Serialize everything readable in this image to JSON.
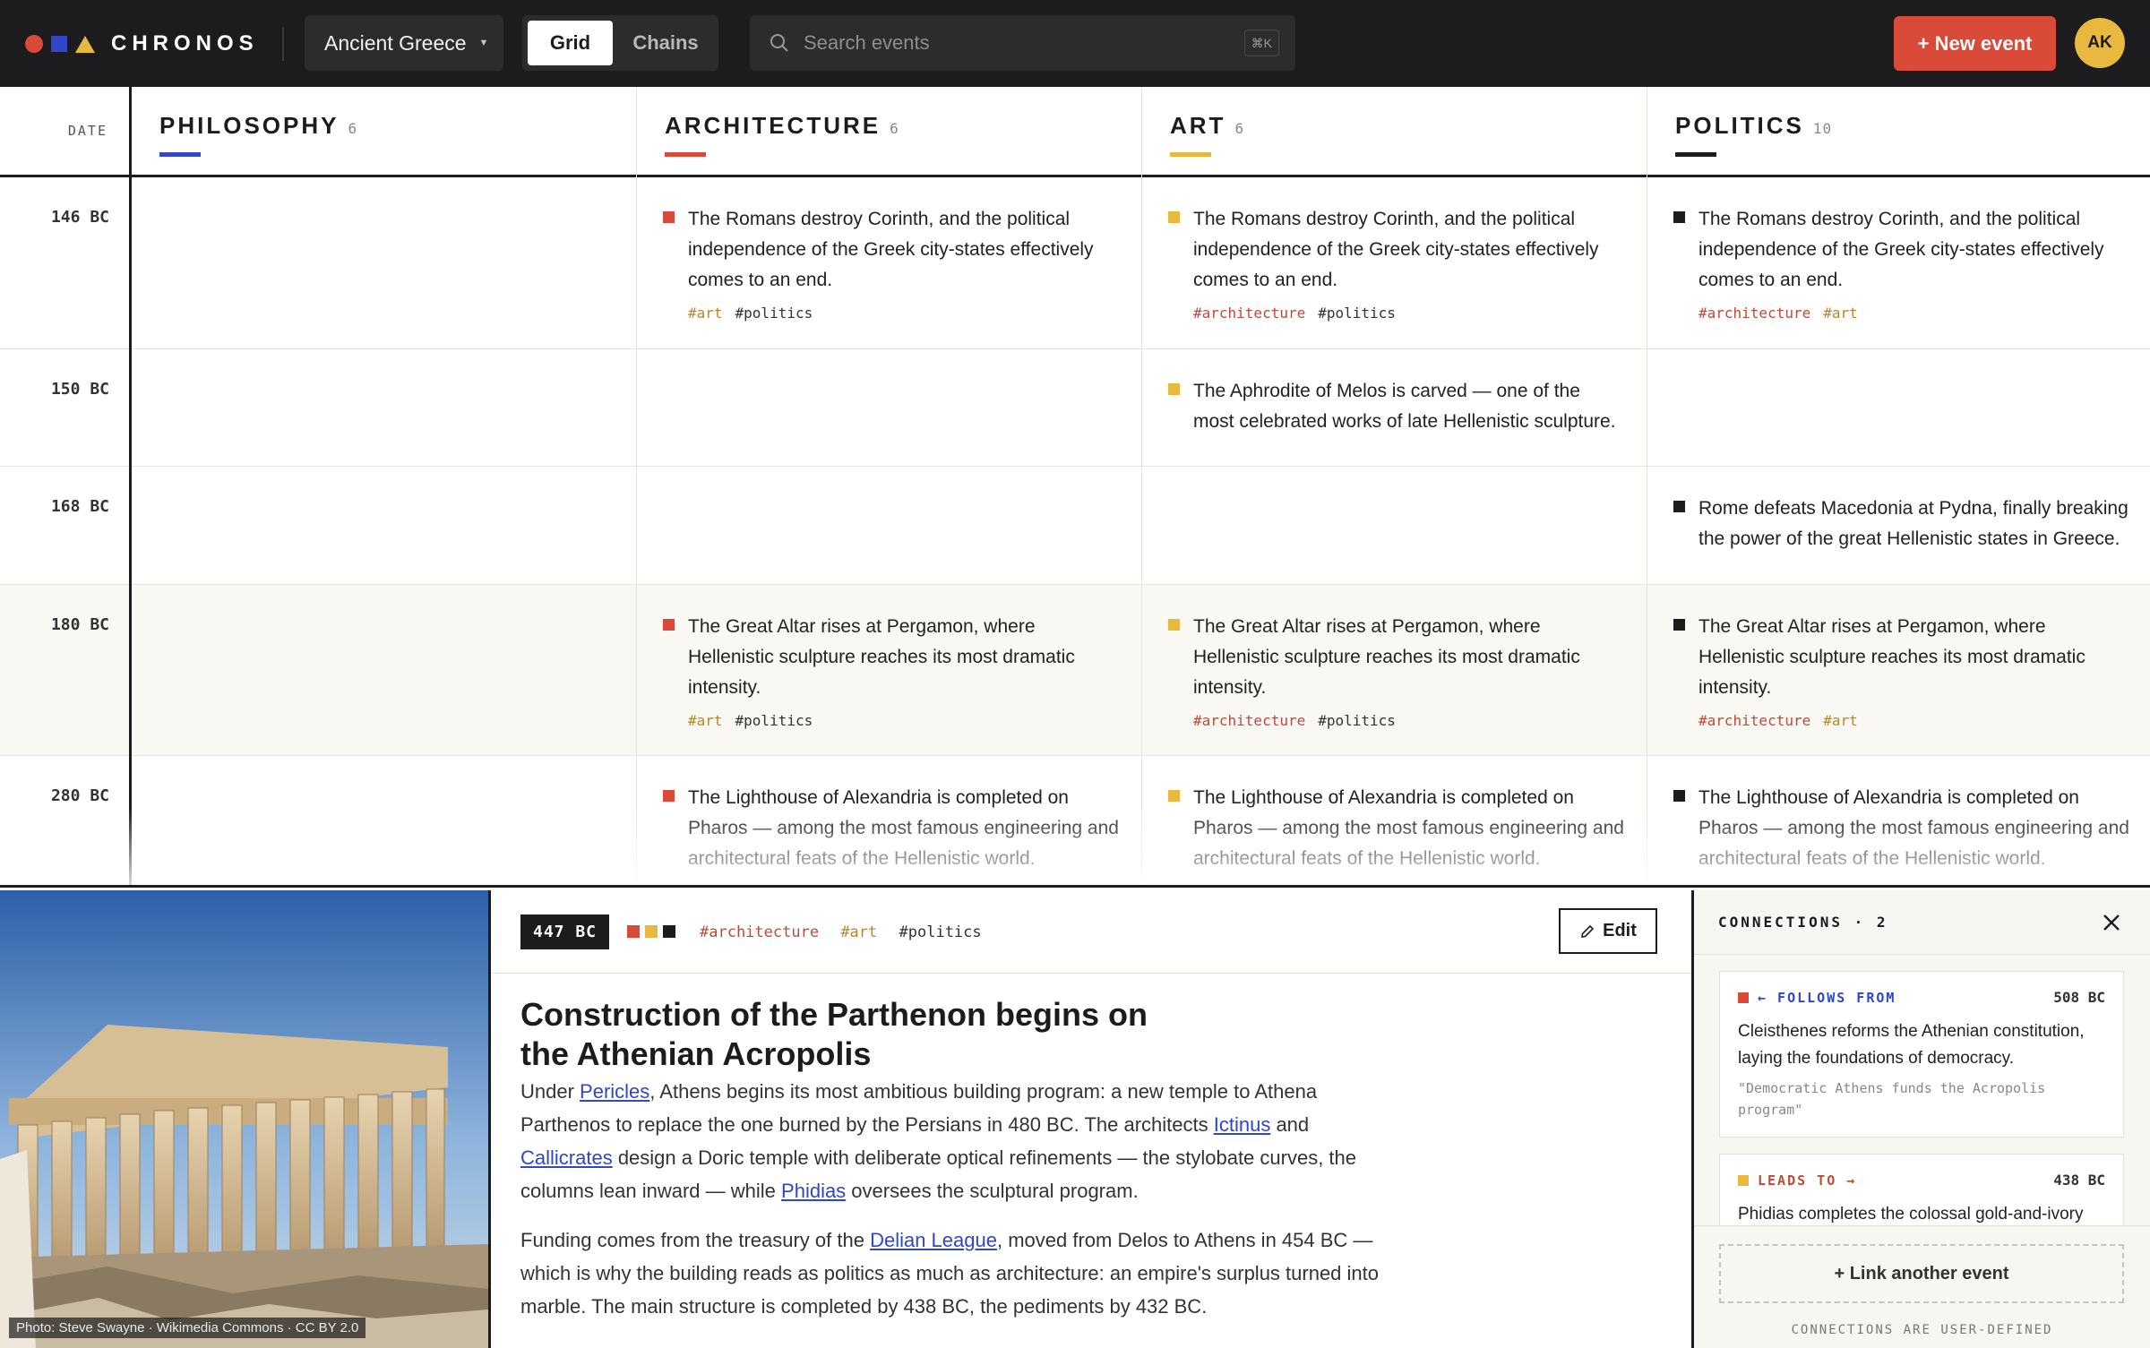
{
  "app": {
    "name": "CHRONOS"
  },
  "topbar": {
    "project": "Ancient Greece",
    "views": [
      "Grid",
      "Chains"
    ],
    "active_view": "Grid",
    "search_placeholder": "Search events",
    "search_shortcut": "⌘K",
    "new_event_label": "+ New event",
    "avatar_initials": "AK"
  },
  "grid": {
    "date_header": "DATE",
    "columns": [
      {
        "name": "PHILOSOPHY",
        "count": "6",
        "color": "#2f47c8"
      },
      {
        "name": "ARCHITECTURE",
        "count": "6",
        "color": "#d94a38"
      },
      {
        "name": "ART",
        "count": "6",
        "color": "#e8b93e"
      },
      {
        "name": "POLITICS",
        "count": "10",
        "color": "#1c1c1e"
      }
    ],
    "rows": [
      {
        "date": "146 BC",
        "cells": [
          null,
          {
            "text": "The Romans destroy Corinth, and the political independence of the Greek city-states effectively comes to an end.",
            "tags": [
              "#art",
              "#politics"
            ]
          },
          {
            "text": "The Romans destroy Corinth, and the political independence of the Greek city-states effectively comes to an end.",
            "tags": [
              "#architecture",
              "#politics"
            ]
          },
          {
            "text": "The Romans destroy Corinth, and the political independence of the Greek city-states effectively comes to an end.",
            "tags": [
              "#architecture",
              "#art"
            ]
          }
        ]
      },
      {
        "date": "150 BC",
        "cells": [
          null,
          null,
          {
            "text": "The Aphrodite of Melos is carved — one of the most celebrated works of late Hellenistic sculpture.",
            "tags": []
          },
          null
        ]
      },
      {
        "date": "168 BC",
        "cells": [
          null,
          null,
          null,
          {
            "text": "Rome defeats Macedonia at Pydna, finally breaking the power of the great Hellenistic states in Greece.",
            "tags": []
          }
        ]
      },
      {
        "date": "180 BC",
        "cells": [
          null,
          {
            "text": "The Great Altar rises at Pergamon, where Hellenistic sculpture reaches its most dramatic intensity.",
            "tags": [
              "#art",
              "#politics"
            ]
          },
          {
            "text": "The Great Altar rises at Pergamon, where Hellenistic sculpture reaches its most dramatic intensity.",
            "tags": [
              "#architecture",
              "#politics"
            ]
          },
          {
            "text": "The Great Altar rises at Pergamon, where Hellenistic sculpture reaches its most dramatic intensity.",
            "tags": [
              "#architecture",
              "#art"
            ]
          }
        ]
      },
      {
        "date": "280 BC",
        "cells": [
          null,
          {
            "text": "The Lighthouse of Alexandria is completed on Pharos — among the most famous engineering and architectural feats of the Hellenistic world.",
            "tags": []
          },
          {
            "text": "The Lighthouse of Alexandria is completed on Pharos — among the most famous engineering and architectural feats of the Hellenistic world.",
            "tags": []
          },
          {
            "text": "The Lighthouse of Alexandria is completed on Pharos — among the most famous engineering and architectural feats of the Hellenistic world.",
            "tags": []
          }
        ]
      }
    ]
  },
  "detail": {
    "photo_credit": "Photo: Steve Swayne · Wikimedia Commons · CC BY 2.0",
    "date": "447 BC",
    "category_colors": [
      "#d94a38",
      "#e8b93e",
      "#1c1c1e"
    ],
    "tags": [
      "#architecture",
      "#art",
      "#politics"
    ],
    "edit_label": "Edit",
    "title": "Construction of the Parthenon begins on the Athenian Acropolis",
    "paragraph1": [
      {
        "t": "Under "
      },
      {
        "t": "Pericles",
        "link": true
      },
      {
        "t": ", Athens begins its most ambitious building program: a new temple to Athena Parthenos to replace the one burned by the Persians in 480 BC. The architects "
      },
      {
        "t": "Ictinus",
        "link": true
      },
      {
        "t": " and "
      },
      {
        "t": "Callicrates",
        "link": true
      },
      {
        "t": " design a Doric temple with deliberate optical refinements — the stylobate curves, the columns lean inward — while "
      },
      {
        "t": "Phidias",
        "link": true
      },
      {
        "t": " oversees the sculptural program."
      }
    ],
    "paragraph2": [
      {
        "t": "Funding comes from the treasury of the "
      },
      {
        "t": "Delian League",
        "link": true
      },
      {
        "t": ", moved from Delos to Athens in 454 BC — which is why the building reads as politics as much as architecture: an empire's surplus turned into marble. The main structure is completed by 438 BC, the pediments by 432 BC."
      }
    ]
  },
  "connections": {
    "title": "CONNECTIONS · 2",
    "items": [
      {
        "relation": "← FOLLOWS FROM",
        "relation_color": "#2f47c8",
        "marker_color": "#d94a38",
        "date": "508 BC",
        "text": "Cleisthenes reforms the Athenian constitution, laying the foundations of democracy.",
        "quote": "\"Democratic Athens funds the Acropolis program\""
      },
      {
        "relation": "LEADS TO →",
        "relation_color": "#c04a36",
        "marker_color": "#e8b93e",
        "date": "438 BC",
        "text": "Phidias completes the colossal gold-and-ivory",
        "quote": ""
      }
    ],
    "link_label": "+ Link another event",
    "note": "CONNECTIONS ARE USER-DEFINED"
  }
}
